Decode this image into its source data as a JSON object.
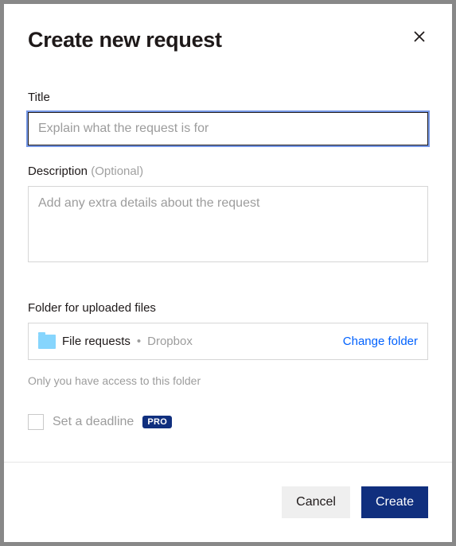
{
  "dialog": {
    "heading": "Create new request",
    "title_field": {
      "label": "Title",
      "placeholder": "Explain what the request is for",
      "value": ""
    },
    "description_field": {
      "label": "Description",
      "optional_text": "(Optional)",
      "placeholder": "Add any extra details about the request",
      "value": ""
    },
    "folder_section": {
      "label": "Folder for uploaded files",
      "folder_name": "File requests",
      "separator": "•",
      "folder_path": "Dropbox",
      "change_label": "Change folder",
      "helper_text": "Only you have access to this folder"
    },
    "deadline": {
      "label": "Set a deadline",
      "badge": "PRO",
      "checked": false
    },
    "actions": {
      "cancel": "Cancel",
      "create": "Create"
    }
  }
}
